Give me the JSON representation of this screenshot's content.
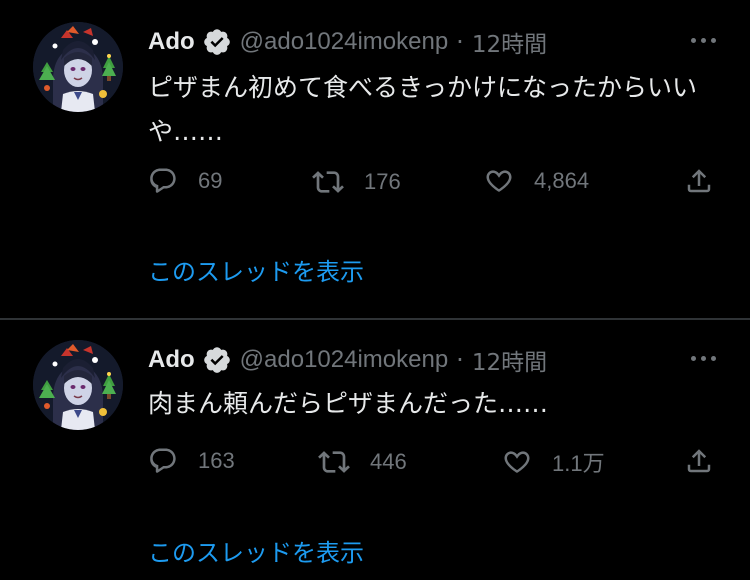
{
  "tweets": [
    {
      "display_name": "Ado",
      "handle": "@ado1024imokenp",
      "separator": "·",
      "time": "12時間",
      "text": "ピザまん初めて食べるきっかけになったからいいや……",
      "reply_count": "69",
      "retweet_count": "176",
      "like_count": "4,864",
      "thread_link": "このスレッドを表示"
    },
    {
      "display_name": "Ado",
      "handle": "@ado1024imokenp",
      "separator": "·",
      "time": "12時間",
      "text": "肉まん頼んだらピザまんだった……",
      "reply_count": "163",
      "retweet_count": "446",
      "like_count": "1.1万",
      "thread_link": "このスレッドを表示"
    }
  ],
  "colors": {
    "background": "#000000",
    "text_primary": "#e7e9ea",
    "text_secondary": "#71767b",
    "link": "#1d9bf0",
    "divider": "#2f3336"
  },
  "icons": {
    "verified": "verified-badge-icon",
    "more": "more-horizontal-icon",
    "reply": "reply-icon",
    "retweet": "retweet-icon",
    "like": "heart-icon",
    "share": "share-icon"
  }
}
